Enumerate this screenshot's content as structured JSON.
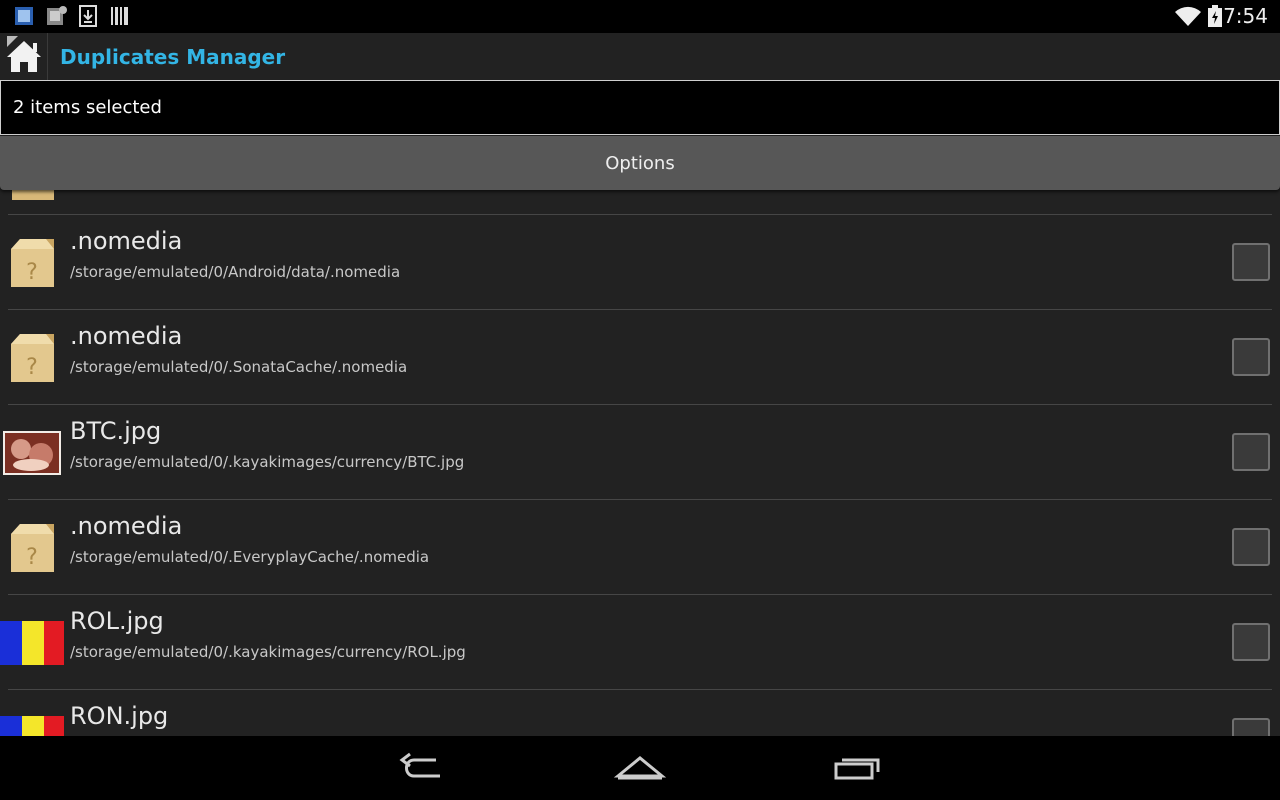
{
  "status_bar": {
    "time": "7:54",
    "icons": [
      "notification-app-icon",
      "notification-app-icon",
      "download-icon",
      "barcode-icon",
      "wifi-icon",
      "battery-charging-icon"
    ]
  },
  "action_bar": {
    "title": "Duplicates Manager",
    "home_icon": "home-icon"
  },
  "selection": {
    "text": "2 items selected"
  },
  "options": {
    "label": "Options"
  },
  "files": [
    {
      "name": ".nomedia",
      "path": "/storage/emulated/0/Android/data/.nomedia",
      "icon": "unknown-file-box-icon",
      "checked": false
    },
    {
      "name": ".nomedia",
      "path": "/storage/emulated/0/.SonataCache/.nomedia",
      "icon": "unknown-file-box-icon",
      "checked": false
    },
    {
      "name": "BTC.jpg",
      "path": "/storage/emulated/0/.kayakimages/currency/BTC.jpg",
      "icon": "image-thumbnail",
      "checked": false
    },
    {
      "name": ".nomedia",
      "path": "/storage/emulated/0/.EveryplayCache/.nomedia",
      "icon": "unknown-file-box-icon",
      "checked": false
    },
    {
      "name": "ROL.jpg",
      "path": "/storage/emulated/0/.kayakimages/currency/ROL.jpg",
      "icon": "flag-thumbnail",
      "checked": false
    },
    {
      "name": "RON.jpg",
      "path": "",
      "icon": "flag-thumbnail",
      "checked": false
    }
  ],
  "nav_bar": {
    "buttons": [
      "back-icon",
      "home-nav-icon",
      "recents-icon"
    ]
  },
  "colors": {
    "accent": "#33b5e5",
    "background": "#222222"
  }
}
